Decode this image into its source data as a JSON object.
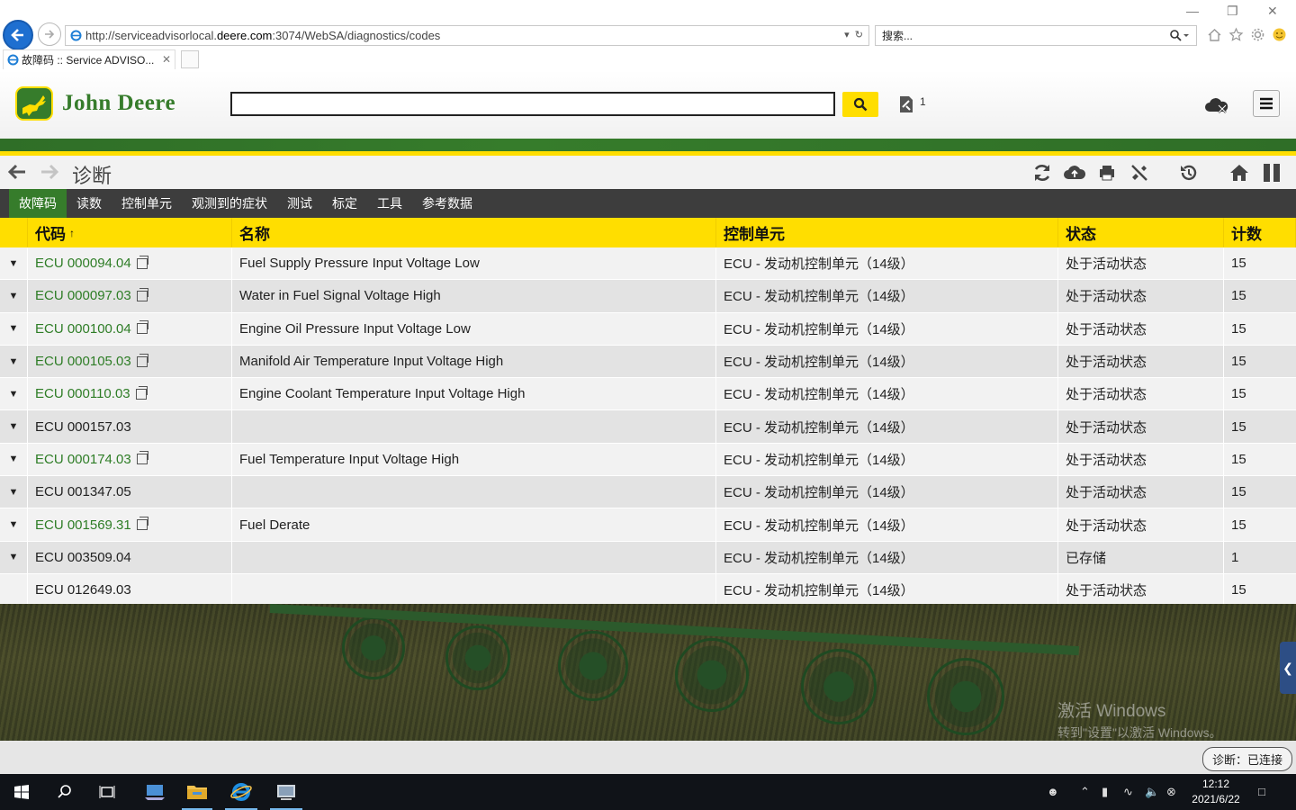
{
  "browser": {
    "url_prefix": "http://serviceadvisorlocal.",
    "url_host": "deere.com",
    "url_suffix": ":3074/WebSA/diagnostics/codes",
    "search_placeholder": "搜索...",
    "tab_title": "故障码 :: Service ADVISO..."
  },
  "header": {
    "brand": "John Deere",
    "cart_count": "1"
  },
  "toolbar": {
    "title": "诊断"
  },
  "subnav": [
    "故障码",
    "读数",
    "控制单元",
    "观测到的症状",
    "测试",
    "标定",
    "工具",
    "参考数据"
  ],
  "table": {
    "headers": [
      "代码",
      "名称",
      "控制单元",
      "状态",
      "计数"
    ],
    "sort_indicator": "↑",
    "rows": [
      {
        "code": "ECU 000094.04",
        "link": true,
        "name": "Fuel Supply Pressure Input Voltage Low",
        "unit": "ECU - 发动机控制单元（14级）",
        "status": "处于活动状态",
        "count": "15",
        "expand": true
      },
      {
        "code": "ECU 000097.03",
        "link": true,
        "name": "Water in Fuel Signal Voltage High",
        "unit": "ECU - 发动机控制单元（14级）",
        "status": "处于活动状态",
        "count": "15",
        "expand": true
      },
      {
        "code": "ECU 000100.04",
        "link": true,
        "name": "Engine Oil Pressure Input Voltage Low",
        "unit": "ECU - 发动机控制单元（14级）",
        "status": "处于活动状态",
        "count": "15",
        "expand": true
      },
      {
        "code": "ECU 000105.03",
        "link": true,
        "name": "Manifold Air Temperature Input Voltage High",
        "unit": "ECU - 发动机控制单元（14级）",
        "status": "处于活动状态",
        "count": "15",
        "expand": true
      },
      {
        "code": "ECU 000110.03",
        "link": true,
        "name": "Engine Coolant Temperature Input Voltage High",
        "unit": "ECU - 发动机控制单元（14级）",
        "status": "处于活动状态",
        "count": "15",
        "expand": true
      },
      {
        "code": "ECU 000157.03",
        "link": false,
        "name": "",
        "unit": "ECU - 发动机控制单元（14级）",
        "status": "处于活动状态",
        "count": "15",
        "expand": true
      },
      {
        "code": "ECU 000174.03",
        "link": true,
        "name": "Fuel Temperature Input Voltage High",
        "unit": "ECU - 发动机控制单元（14级）",
        "status": "处于活动状态",
        "count": "15",
        "expand": true
      },
      {
        "code": "ECU 001347.05",
        "link": false,
        "name": "",
        "unit": "ECU - 发动机控制单元（14级）",
        "status": "处于活动状态",
        "count": "15",
        "expand": true
      },
      {
        "code": "ECU 001569.31",
        "link": true,
        "name": "Fuel Derate",
        "unit": "ECU - 发动机控制单元（14级）",
        "status": "处于活动状态",
        "count": "15",
        "expand": true
      },
      {
        "code": "ECU 003509.04",
        "link": false,
        "name": "",
        "unit": "ECU - 发动机控制单元（14级）",
        "status": "已存储",
        "count": "1",
        "expand": true
      },
      {
        "code": "ECU 012649.03",
        "link": false,
        "name": "",
        "unit": "ECU - 发动机控制单元（14级）",
        "status": "处于活动状态",
        "count": "15",
        "expand": false
      }
    ]
  },
  "watermark": {
    "line1": "激活 Windows",
    "line2": "转到\"设置\"以激活 Windows。"
  },
  "status": {
    "text": "诊断：已连接"
  },
  "taskbar": {
    "time": "12:12",
    "date": "2021/6/22"
  },
  "colors": {
    "brand_green": "#367c2b",
    "brand_yellow": "#ffde00",
    "link_green": "#2e7d26"
  }
}
